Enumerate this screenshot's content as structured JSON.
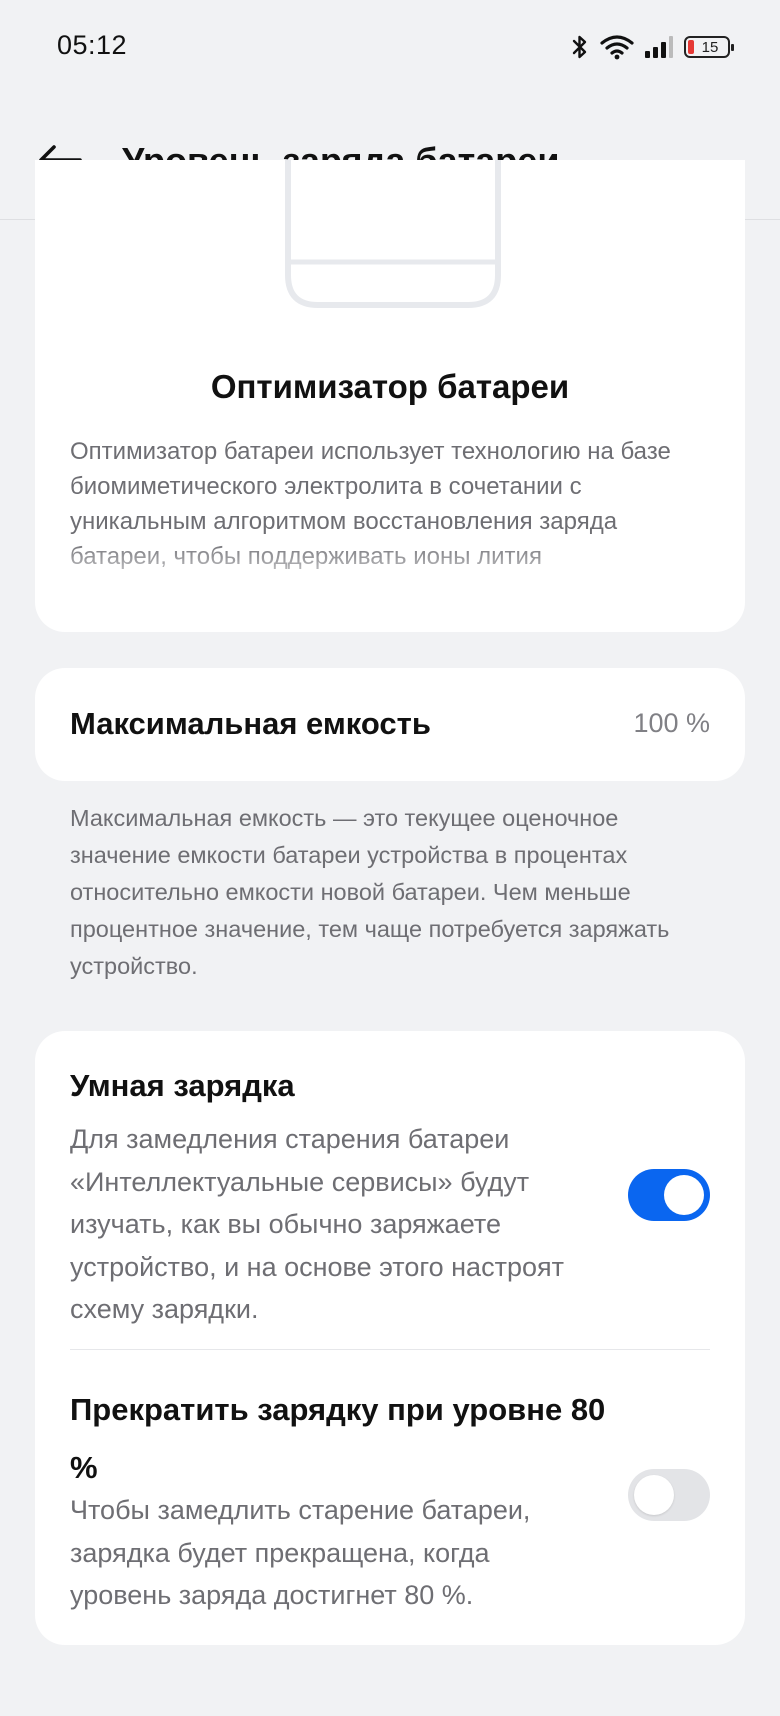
{
  "status_bar": {
    "time": "05:12",
    "battery_level": "15",
    "icons": [
      "bluetooth-icon",
      "wifi-icon",
      "signal-icon",
      "battery-icon"
    ]
  },
  "app_bar": {
    "title": "Уровень заряда батареи",
    "back_icon": "arrow-left-icon"
  },
  "optimizer": {
    "title": "Оптимизатор батареи",
    "description": "Оптимизатор батареи использует технологию на базе биомиметического электролита в сочетании с уникальным алгоритмом восстановления заряда батареи, чтобы поддерживать ионы лития"
  },
  "capacity": {
    "label": "Максимальная емкость",
    "value": "100 %",
    "note": "Максимальная емкость — это текущее оценочное значение емкости батареи устройства в процентах относительно емкости новой батареи. Чем меньше процентное значение, тем чаще потребуется заряжать устройство."
  },
  "smart_charging": {
    "title": "Умная зарядка",
    "description": "Для замедления старения батареи «Интеллектуальные сервисы» будут изучать, как вы обычно заряжаете устройство, и на основе этого настроят схему зарядки.",
    "enabled": true
  },
  "stop_charging": {
    "title": "Прекратить зарядку при уровне 80 %",
    "description": "Чтобы замедлить старение батареи, зарядка будет прекращена, когда уровень заряда достигнет 80 %.",
    "enabled": false
  },
  "colors": {
    "accent": "#0a66f0",
    "background": "#f1f2f4",
    "card": "#ffffff",
    "secondary_text": "#6e6e73",
    "battery_low": "#e53935"
  }
}
